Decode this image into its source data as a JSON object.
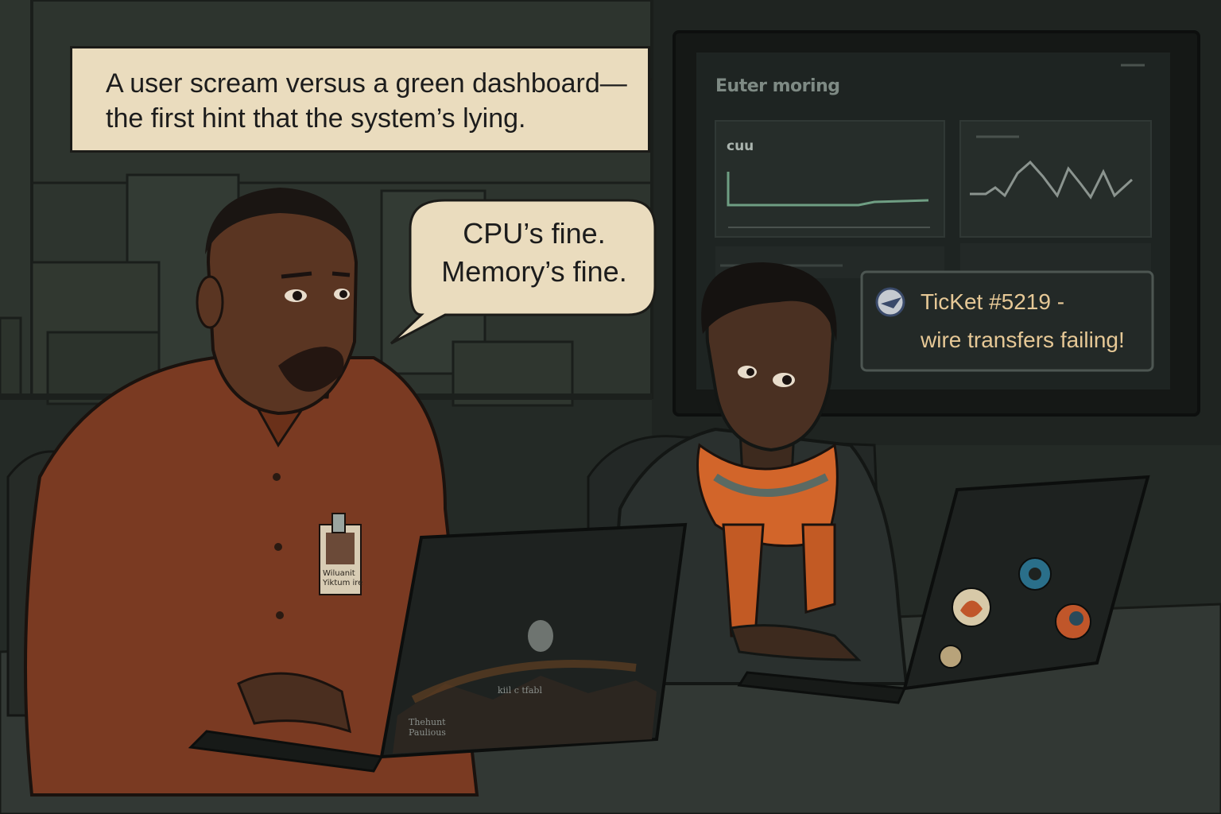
{
  "caption": {
    "line1": "A user scream versus a green dashboard—",
    "line2": "the first hint that the system’s lying."
  },
  "speech_bubble": {
    "line1": "CPU’s fine.",
    "line2": "Memory’s fine."
  },
  "monitor": {
    "title": "Euter moring",
    "panel_label": "cuu"
  },
  "notification": {
    "line1": "TicKet #5219 -",
    "line2": "wire transfers failing!"
  },
  "badge": {
    "line1": "Wiluanit",
    "line2": "Yiktum ire"
  },
  "laptop": {
    "left_sticker": "Thehunt Paulious",
    "center_text": "kiil c tfabl"
  },
  "colors": {
    "caption_bg": "#eadcbe",
    "shirt": "#7a3a22",
    "scarf": "#d2652a",
    "notification_text": "#e6c896",
    "dashboard_line": "#6f9e83"
  }
}
